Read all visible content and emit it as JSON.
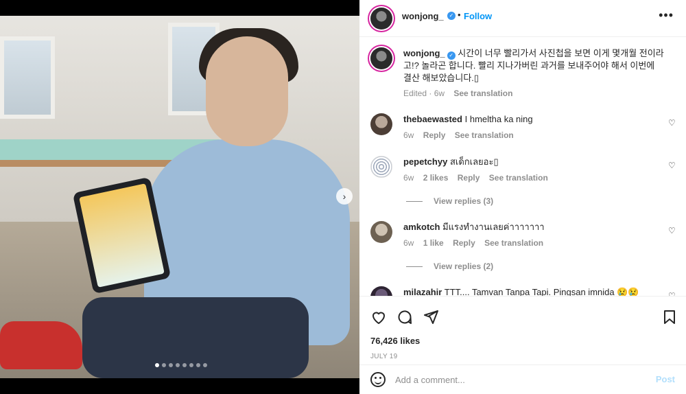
{
  "post": {
    "author": "wonjong_",
    "follow_label": "Follow",
    "separator": "•",
    "more_icon": "more-horizontal-icon",
    "caption": "시간이 너무 빨리가서 사진첩을 보면 이게 몇개월 전이라고!? 놀라곤 합니다. 빨리 지나가버린 과거를 보내주어야 해서 이번에 결산 해보았습니다.",
    "caption_meta": {
      "edited": "Edited · 6w",
      "see_translation": "See translation"
    },
    "likes": "76,426 likes",
    "date": "JULY 19",
    "carousel_dots": 8,
    "carousel_active": 0
  },
  "comments": [
    {
      "user": "thebaewasted",
      "text": "I hmeltha ka ning",
      "time": "6w",
      "likes": "",
      "reply": "Reply",
      "see_translation": "See translation",
      "view_replies": ""
    },
    {
      "user": "pepetchyy",
      "text": "สเด็กเลยอะ",
      "time": "6w",
      "likes": "2 likes",
      "reply": "Reply",
      "see_translation": "See translation",
      "view_replies": "View replies (3)"
    },
    {
      "user": "amkotch",
      "text": "มีแรงทำงานเลยค่าาาาาาา",
      "time": "6w",
      "likes": "1 like",
      "reply": "Reply",
      "see_translation": "See translation",
      "view_replies": "View replies (2)"
    },
    {
      "user": "milazahir",
      "text": "TTT.... Tamvan Tanpa Tapi. Pingsan imnida 😢😢",
      "time": "",
      "likes": "",
      "reply": "",
      "see_translation": "",
      "view_replies": ""
    }
  ],
  "comment_box": {
    "placeholder": "Add a comment...",
    "post_label": "Post"
  },
  "colors": {
    "accent": "#0095f6",
    "verified": "#3897f0",
    "muted": "#8e8e8e",
    "post_disabled": "#b2dffc"
  }
}
